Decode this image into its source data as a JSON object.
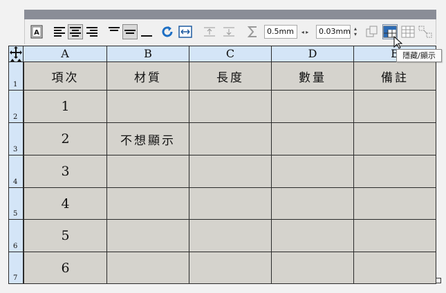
{
  "toolbar": {
    "line_width_value": "0.5mm",
    "spacing_value": "0.03mm",
    "icons": [
      "text-frame-icon",
      "align-left-icon",
      "align-center-icon",
      "align-right-icon",
      "valign-top-icon",
      "valign-middle-icon",
      "valign-bottom-icon",
      "refresh-icon",
      "fit-width-icon",
      "insert-row-above-icon",
      "insert-row-below-icon",
      "sum-icon",
      "copy-format-icon",
      "hide-show-icon",
      "grid-icon",
      "merge-cells-icon"
    ]
  },
  "tooltip": {
    "text": "隱藏/顯示"
  },
  "table": {
    "columns": [
      "A",
      "B",
      "C",
      "D",
      "E"
    ],
    "rows": [
      "1",
      "2",
      "3",
      "4",
      "5",
      "6",
      "7"
    ],
    "header": [
      "項次",
      "材質",
      "長度",
      "數量",
      "備註"
    ],
    "body": [
      [
        "1",
        "",
        "",
        "",
        ""
      ],
      [
        "2",
        "不想顯示",
        "",
        "",
        ""
      ],
      [
        "3",
        "",
        "",
        "",
        ""
      ],
      [
        "4",
        "",
        "",
        "",
        ""
      ],
      [
        "5",
        "",
        "",
        "",
        ""
      ],
      [
        "6",
        "",
        "",
        "",
        ""
      ]
    ]
  }
}
